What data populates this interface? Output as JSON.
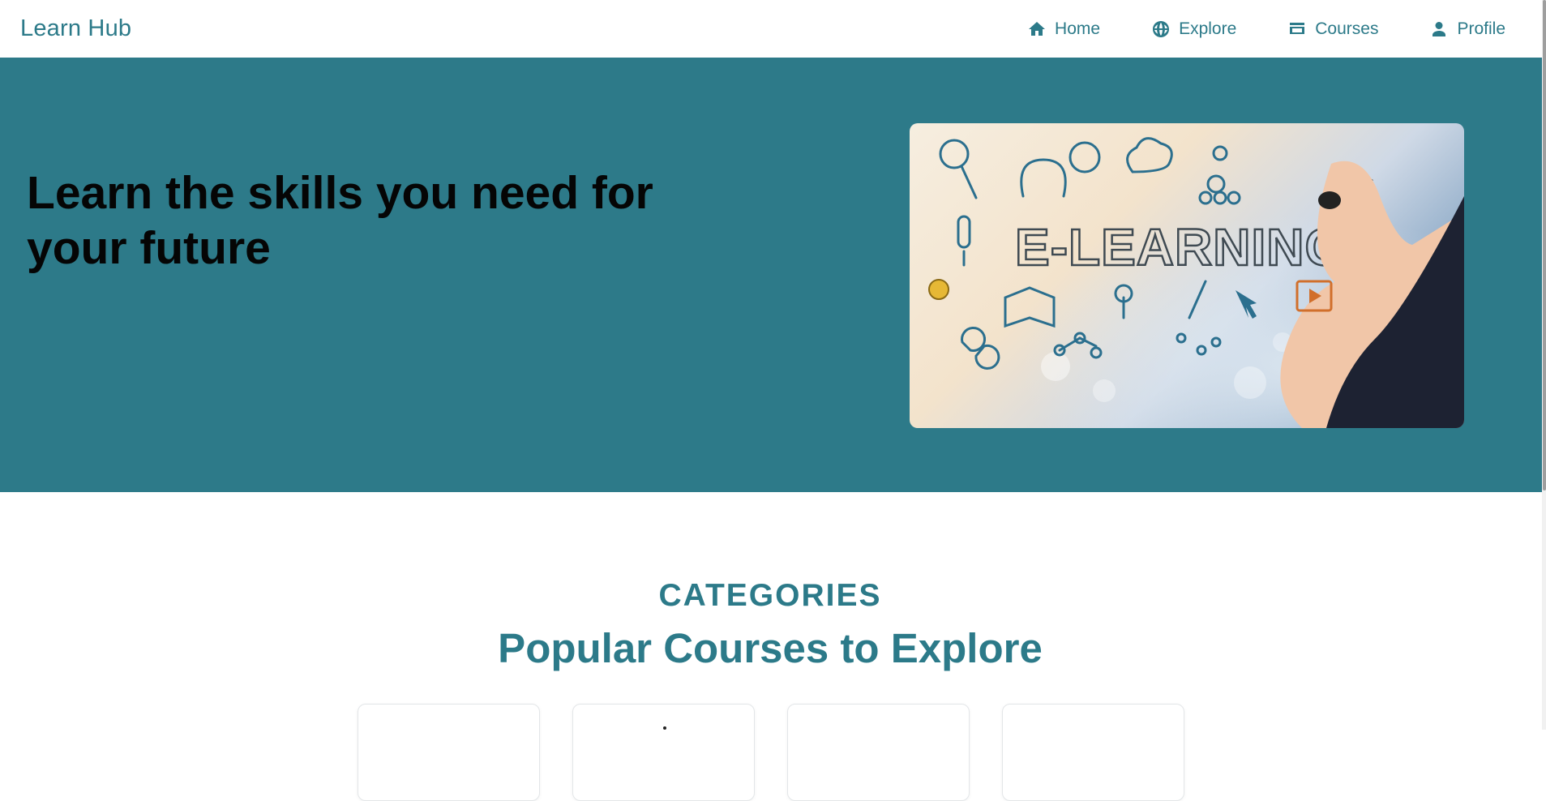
{
  "brand": {
    "name": "Learn Hub"
  },
  "nav": {
    "items": [
      {
        "label": "Home",
        "icon": "home-icon"
      },
      {
        "label": "Explore",
        "icon": "globe-icon"
      },
      {
        "label": "Courses",
        "icon": "courses-icon"
      },
      {
        "label": "Profile",
        "icon": "person-icon"
      }
    ]
  },
  "hero": {
    "title": "Learn the skills you need for your future",
    "image_text": "E-LEARNING"
  },
  "categories": {
    "kicker": "CATEGORIES",
    "title": "Popular Courses to Explore"
  },
  "colors": {
    "accent": "#2c7a89",
    "hero_bg": "#2d7a89",
    "hero_text": "#050505"
  }
}
